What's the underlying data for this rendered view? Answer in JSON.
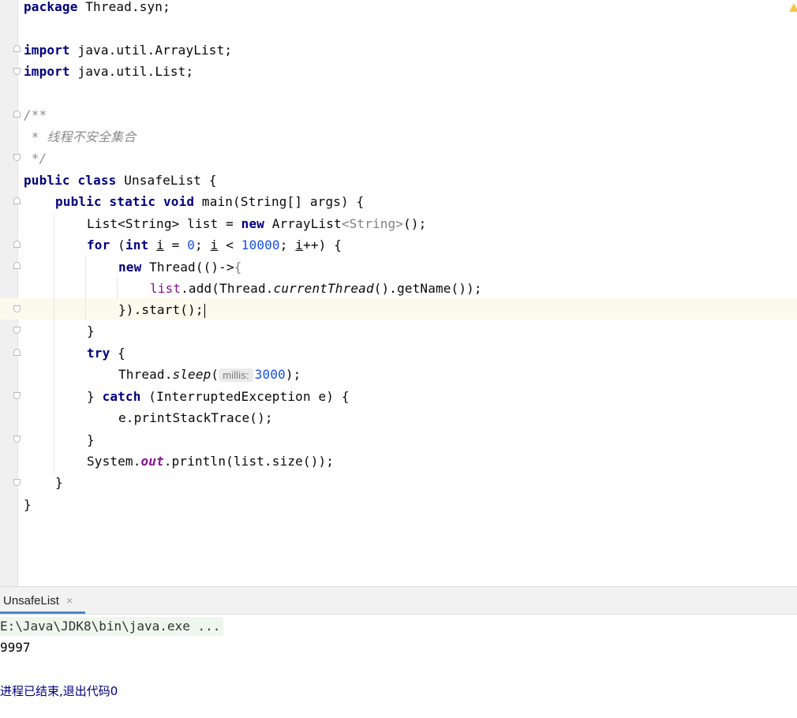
{
  "editor": {
    "lines": {
      "pkg_kw": "package",
      "pkg_name": " Thread.syn;",
      "imp_kw": "import",
      "imp1": " java.util.ArrayList;",
      "imp2": " java.util.List;",
      "doc_open": "/**",
      "doc_body": " * 线程不安全集合",
      "doc_close": " */",
      "cls_kw1": "public",
      "cls_kw2": "class",
      "cls_name": " UnsafeList {",
      "main_kw1": "public",
      "main_kw2": "static",
      "main_kw3": "void",
      "main_sig": " main(String[] args) {",
      "list_decl_a": "List<String> list = ",
      "new_kw": "new",
      "list_decl_b": " ArrayList",
      "list_decl_gen": "<String>",
      "list_decl_c": "();",
      "for_kw": "for",
      "for_a": " (",
      "int_kw": "int",
      "var_i": "i",
      "for_eq": " = ",
      "zero": "0",
      "for_semi": "; ",
      "for_lt": " < ",
      "ten_k": "10000",
      "for_inc": "++) {",
      "thread_new_b": " Thread(()->",
      "brace_gray": "{",
      "list_field": "list",
      "add_a": ".add(Thread.",
      "current_thread": "currentThread",
      "add_b": "().getName());",
      "start_call": "}).start();",
      "close1": "}",
      "try_kw": "try",
      "try_b": " {",
      "sleep_a": "Thread.",
      "sleep_m": "sleep",
      "sleep_paren": "(",
      "hint_millis": "millis:",
      "three_k": "3000",
      "sleep_end": ");",
      "catch_a": "} ",
      "catch_kw": "catch",
      "catch_b": " (InterruptedException e) {",
      "print_trace": "e.printStackTrace();",
      "close2": "}",
      "sys_a": "System.",
      "sys_out": "out",
      "sys_b": ".println(list.size());",
      "close3": "}",
      "close4": "}"
    }
  },
  "run": {
    "tab_label": "UnsafeList",
    "tab_close": "×",
    "command": "E:\\Java\\JDK8\\bin\\java.exe ...",
    "output": "9997",
    "exit_message": "进程已结束,退出代码0"
  },
  "colors": {
    "keyword": "#0033b3",
    "number": "#1750eb",
    "comment": "#8c8c8c",
    "field": "#871094",
    "caret_line": "#fcfaed",
    "warning": "#f2c744"
  },
  "icons": [
    "fold-marker-icon",
    "warning-icon",
    "close-icon"
  ]
}
